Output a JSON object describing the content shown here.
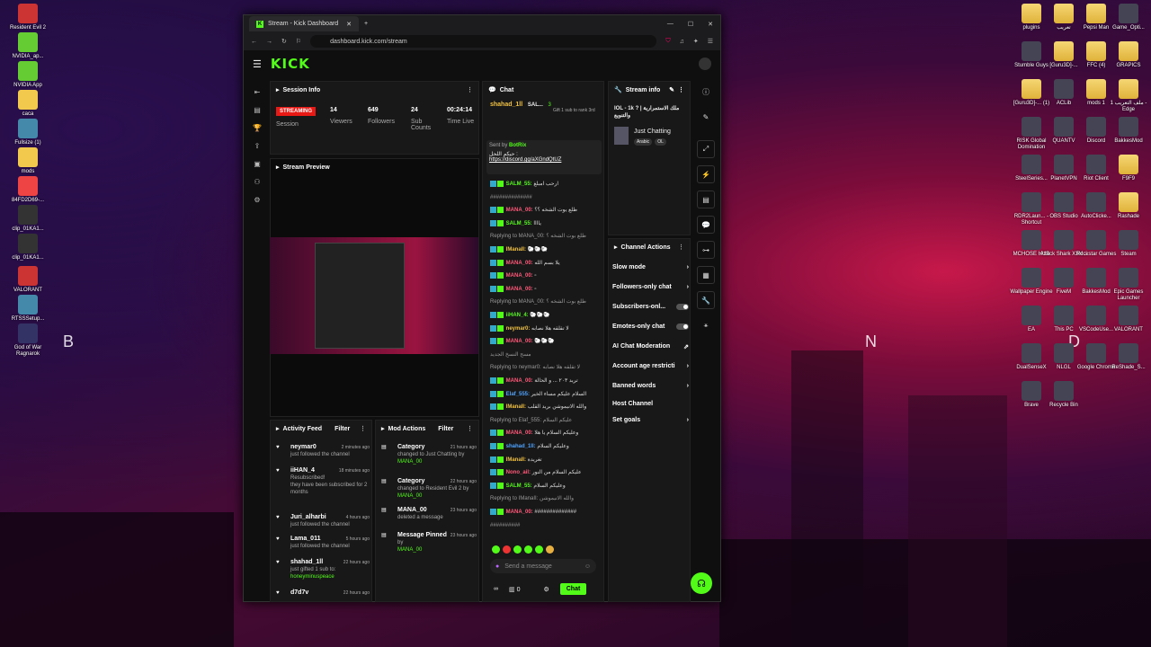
{
  "desktop": {
    "left_icons": [
      "Resident Evil 2",
      "NVIDIA_ap...",
      "NVIDIA App",
      "caca",
      "Fullsize (1)",
      "mods",
      "84FD2D69-...",
      "clip_01KA1...",
      "clip_01KA1...",
      "VALORANT",
      "RTSSSetup...",
      "God of War Ragnarok"
    ],
    "right_icons": [
      "plugins",
      "تعريب",
      "Pepsi Man",
      "Game_Opti...",
      "Stumble Guys",
      "[Guru3D]-...",
      "FFC (4)",
      "GRAPICS",
      "[Guru3D]-... (1)",
      "ACLib",
      "mods 1",
      "ملف التعريب 1 - Edge",
      "RISK Global Domination",
      "QUANTV",
      "Discord",
      "BakkesMod",
      "SteelSeries...",
      "PlanetVPN",
      "Riot Client",
      "F9F9",
      "RDR2Laun... - Shortcut",
      "OBS Studio",
      "AutoClicke...",
      "Rashade",
      "MCHOSE HUB",
      "Attack Shark X3M...",
      "Rockstar Games",
      "Steam",
      "Wallpaper Engine",
      "FiveM",
      "BakkesMod",
      "Epic Games Launcher",
      "EA",
      "This PC",
      "VSCodeUse...",
      "VALORANT",
      "DualSenseX",
      "NLGL",
      "Google Chrome",
      "ReShade_S...",
      "Brave",
      "Recycle Bin"
    ],
    "wall_letters": [
      "B",
      "N",
      "D"
    ]
  },
  "browser": {
    "tab_title": "Stream - Kick Dashboard",
    "url": "dashboard.kick.com/stream"
  },
  "kick": {
    "logo": "KICK",
    "session": {
      "title": "Session Info",
      "status": "STREAMING",
      "status_label": "Session",
      "viewers": "14",
      "viewers_label": "Viewers",
      "followers": "649",
      "followers_label": "Followers",
      "subs": "24",
      "subs_label": "Sub Counts",
      "time": "00:24:14",
      "time_label": "Time Live"
    },
    "preview": {
      "title": "Stream Preview"
    },
    "activity": {
      "title": "Activity Feed",
      "filter": "Filter",
      "items": [
        {
          "name": "neymar0",
          "time": "2 minutes ago",
          "desc": "just followed the channel"
        },
        {
          "name": "iiHAN_4",
          "time": "18 minutes ago",
          "desc": "Resubscribed!",
          "extra": "they have been subscribed for 2 months"
        },
        {
          "name": "Juri_alharbi",
          "time": "4 hours ago",
          "desc": "just followed the channel"
        },
        {
          "name": "Lama_011",
          "time": "5 hours ago",
          "desc": "just followed the channel"
        },
        {
          "name": "shahad_1ll",
          "time": "22 hours ago",
          "desc": "just gifted 1 sub to:",
          "extra": "honeyminuspeace"
        },
        {
          "name": "d7d7v",
          "time": "22 hours ago",
          "desc": ""
        }
      ]
    },
    "mod": {
      "title": "Mod Actions",
      "filter": "Filter",
      "items": [
        {
          "name": "Category",
          "time": "21 hours ago",
          "desc": "changed to Just Chatting by",
          "by": "MANA_00"
        },
        {
          "name": "Category",
          "time": "22 hours ago",
          "desc": "changed to Resident Evil 2 by",
          "by": "MANA_00"
        },
        {
          "name": "MANA_00",
          "time": "23 hours ago",
          "desc": "deleted a message",
          "by": ""
        },
        {
          "name": "Message Pinned",
          "time": "23 hours ago",
          "desc": "by",
          "by": "MANA_00"
        }
      ]
    },
    "chat": {
      "title": "Chat",
      "top_user": "shahad_1ll",
      "top_count": "3",
      "top_user2": "SAL...",
      "top_gift": "Gift 1 sub to rank 3rd",
      "pinned_by": "Sent by",
      "pinned_user": "BotRix",
      "pinned_text": "حيكم اللحل :",
      "pinned_link": "https://discord.gg/aXGndQtUZ",
      "lines": [
        {
          "u": "SALM_55:",
          "c": "u1",
          "t": "ارحب امبلغ"
        },
        {
          "u": "",
          "c": "",
          "t": "##############"
        },
        {
          "u": "MANA_00:",
          "c": "u2",
          "t": "طلع يوت الشخه ؟؟"
        },
        {
          "u": "SALM_55:",
          "c": "u1",
          "t": "ياااا"
        },
        {
          "u": "",
          "c": "",
          "t": "Replying to MANA_00: طلع بوت الشخه ؟"
        },
        {
          "u": "IManaII:",
          "c": "u4",
          "t": "🐑🐑🐑"
        },
        {
          "u": "MANA_00:",
          "c": "u2",
          "t": "يلا بسم الله"
        },
        {
          "u": "MANA_00:",
          "c": "u2",
          "t": "▫"
        },
        {
          "u": "MANA_00:",
          "c": "u2",
          "t": "▫"
        },
        {
          "u": "",
          "c": "",
          "t": "Replying to MANA_00: طلع بوت الشخه ؟"
        },
        {
          "u": "iiHAN_4:",
          "c": "u1",
          "t": "🐑🐑🐑"
        },
        {
          "u": "neymar0:",
          "c": "u4",
          "t": "لا تقلقه هلا نصابه"
        },
        {
          "u": "MANA_00:",
          "c": "u2",
          "t": "🐑🐑🐑"
        },
        {
          "u": "",
          "c": "",
          "t": "مسح النسخ الجديد"
        },
        {
          "u": "",
          "c": "",
          "t": "Replying to neymar0: لا تقلقه هلا نصابه"
        },
        {
          "u": "MANA_00:",
          "c": "u2",
          "t": "تريد ٢٠٣ ... و الحالة"
        },
        {
          "u": "Elaf_555:",
          "c": "u3",
          "t": "السلام عليكم مساء الخير"
        },
        {
          "u": "IManaII:",
          "c": "u4",
          "t": "والله الانيموشن بريد القلب"
        },
        {
          "u": "",
          "c": "",
          "t": "Replying to Elaf_555: عليكم السلام"
        },
        {
          "u": "MANA_00:",
          "c": "u2",
          "t": "وعليكم السلام يا هلا"
        },
        {
          "u": "shahad_1ll:",
          "c": "u3",
          "t": "وعليكم السلام"
        },
        {
          "u": "IManaII:",
          "c": "u4",
          "t": "تغريدة"
        },
        {
          "u": "Nono_ail:",
          "c": "u2",
          "t": "عليكم السلام من النور"
        },
        {
          "u": "SALM_55:",
          "c": "u1",
          "t": "وعليكم السلام"
        },
        {
          "u": "",
          "c": "",
          "t": "Replying to IManaII: والله الانيموشن"
        },
        {
          "u": "MANA_00:",
          "c": "u2",
          "t": "##############"
        },
        {
          "u": "",
          "c": "",
          "t": "##########"
        }
      ],
      "placeholder": "Send a message",
      "count": "0",
      "send": "Chat"
    },
    "stream_info": {
      "title": "Stream info",
      "stream_title": "IOL - 1k ? | ملك الاستمرارية والتنويع",
      "category": "Just Chatting",
      "tags": [
        "Arabic",
        "OL"
      ]
    },
    "channel_actions": {
      "title": "Channel Actions",
      "items": [
        "Slow mode",
        "Followers-only chat",
        "Subscribers-onl...",
        "Emotes-only chat",
        "AI Chat Moderation",
        "Account age restricti",
        "Banned words",
        "Host Channel",
        "Set goals"
      ]
    }
  },
  "colors": {
    "kick_green": "#53fc18",
    "live_red": "#e91916"
  }
}
